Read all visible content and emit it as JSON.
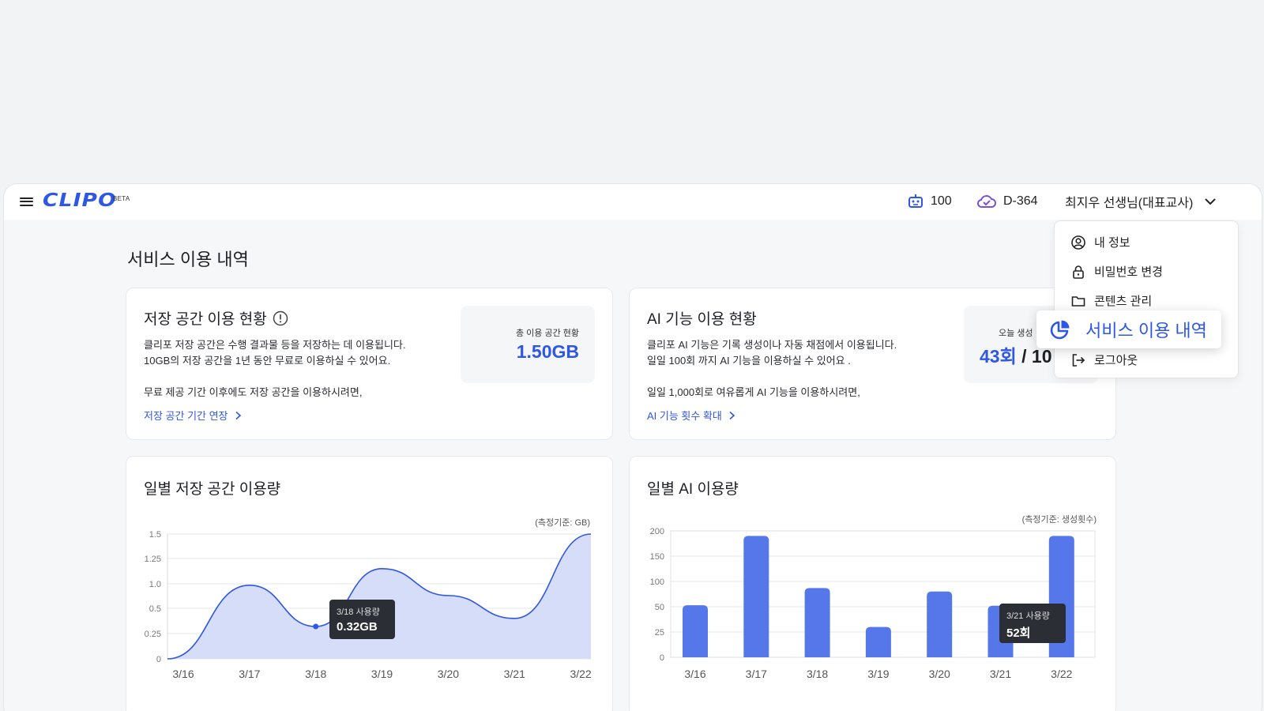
{
  "app": {
    "logo": "CLIPO",
    "badge": "BETA"
  },
  "topbar": {
    "credits": "100",
    "dday": "D-364",
    "user": "최지우 선생님(대표교사)"
  },
  "menu": {
    "items": [
      {
        "label": "내 정보",
        "icon": "user-circle-icon"
      },
      {
        "label": "비밀번호 변경",
        "icon": "lock-icon"
      },
      {
        "label": "콘텐츠 관리",
        "icon": "folder-icon"
      },
      {
        "label": "서비스 이용 내역",
        "icon": "pie-chart-icon",
        "active": true
      },
      {
        "label": "로그아웃",
        "icon": "logout-icon"
      }
    ]
  },
  "page": {
    "title": "서비스 이용 내역"
  },
  "storage_card": {
    "title": "저장 공간 이용 현황",
    "desc_line1": "클리포 저장 공간은 수행 결과물 등을 저장하는 데 이용됩니다.",
    "desc_line2": "10GB의 저장 공간을 1년 동안 무료로 이용하실 수 있어요.",
    "desc_line3": "무료 제공 기간 이후에도 저장 공간을 이용하시려면,",
    "link": "저장 공간 기간 연장",
    "stat_label": "총 이용 공간 현황",
    "stat_value": "1.50GB"
  },
  "ai_card": {
    "title": "AI 기능 이용 현황",
    "desc_line1": "클리포 AI 기능은 기록 생성이나 자동 채점에서 이용됩니다.",
    "desc_line2": "일일 100회 까지 AI 기능을 이용하실 수 있어요 .",
    "desc_line3": "일일 1,000회로 여유롭게 AI 기능을 이용하시려면,",
    "link": "AI 기능 횟수 확대",
    "stat_label": "오늘 생성",
    "stat_value": "43회",
    "stat_total": "10"
  },
  "storage_chart": {
    "title": "일별 저장 공간 이용량",
    "note": "(측정기준: GB)",
    "tooltip_label": "3/18 사용량",
    "tooltip_value": "0.32GB"
  },
  "ai_chart": {
    "title": "일별 AI 이용량",
    "note": "(측정기준: 생성횟수)",
    "tooltip_label": "3/21 사용량",
    "tooltip_value": "52회"
  },
  "chart_data": [
    {
      "type": "area",
      "title": "일별 저장 공간 이용량",
      "x": [
        "3/16",
        "3/17",
        "3/18",
        "3/19",
        "3/20",
        "3/21",
        "3/22"
      ],
      "y_ticks": [
        "0",
        "0.25",
        "0.5",
        "1.0",
        "1.25",
        "1.5"
      ],
      "series": [
        {
          "values": [
            0,
            0.97,
            0.32,
            1.15,
            0.76,
            0.4,
            1.5
          ]
        }
      ],
      "color": "#2f57e6"
    },
    {
      "type": "bar",
      "title": "일별 AI 이용량",
      "categories": [
        "3/16",
        "3/17",
        "3/18",
        "3/19",
        "3/20",
        "3/21",
        "3/22"
      ],
      "y_ticks": [
        "0",
        "25",
        "50",
        "100",
        "150",
        "200"
      ],
      "values": [
        53,
        190,
        87,
        30,
        80,
        52,
        190
      ],
      "color": "#5577ea",
      "ylim": [
        0,
        200
      ]
    }
  ]
}
